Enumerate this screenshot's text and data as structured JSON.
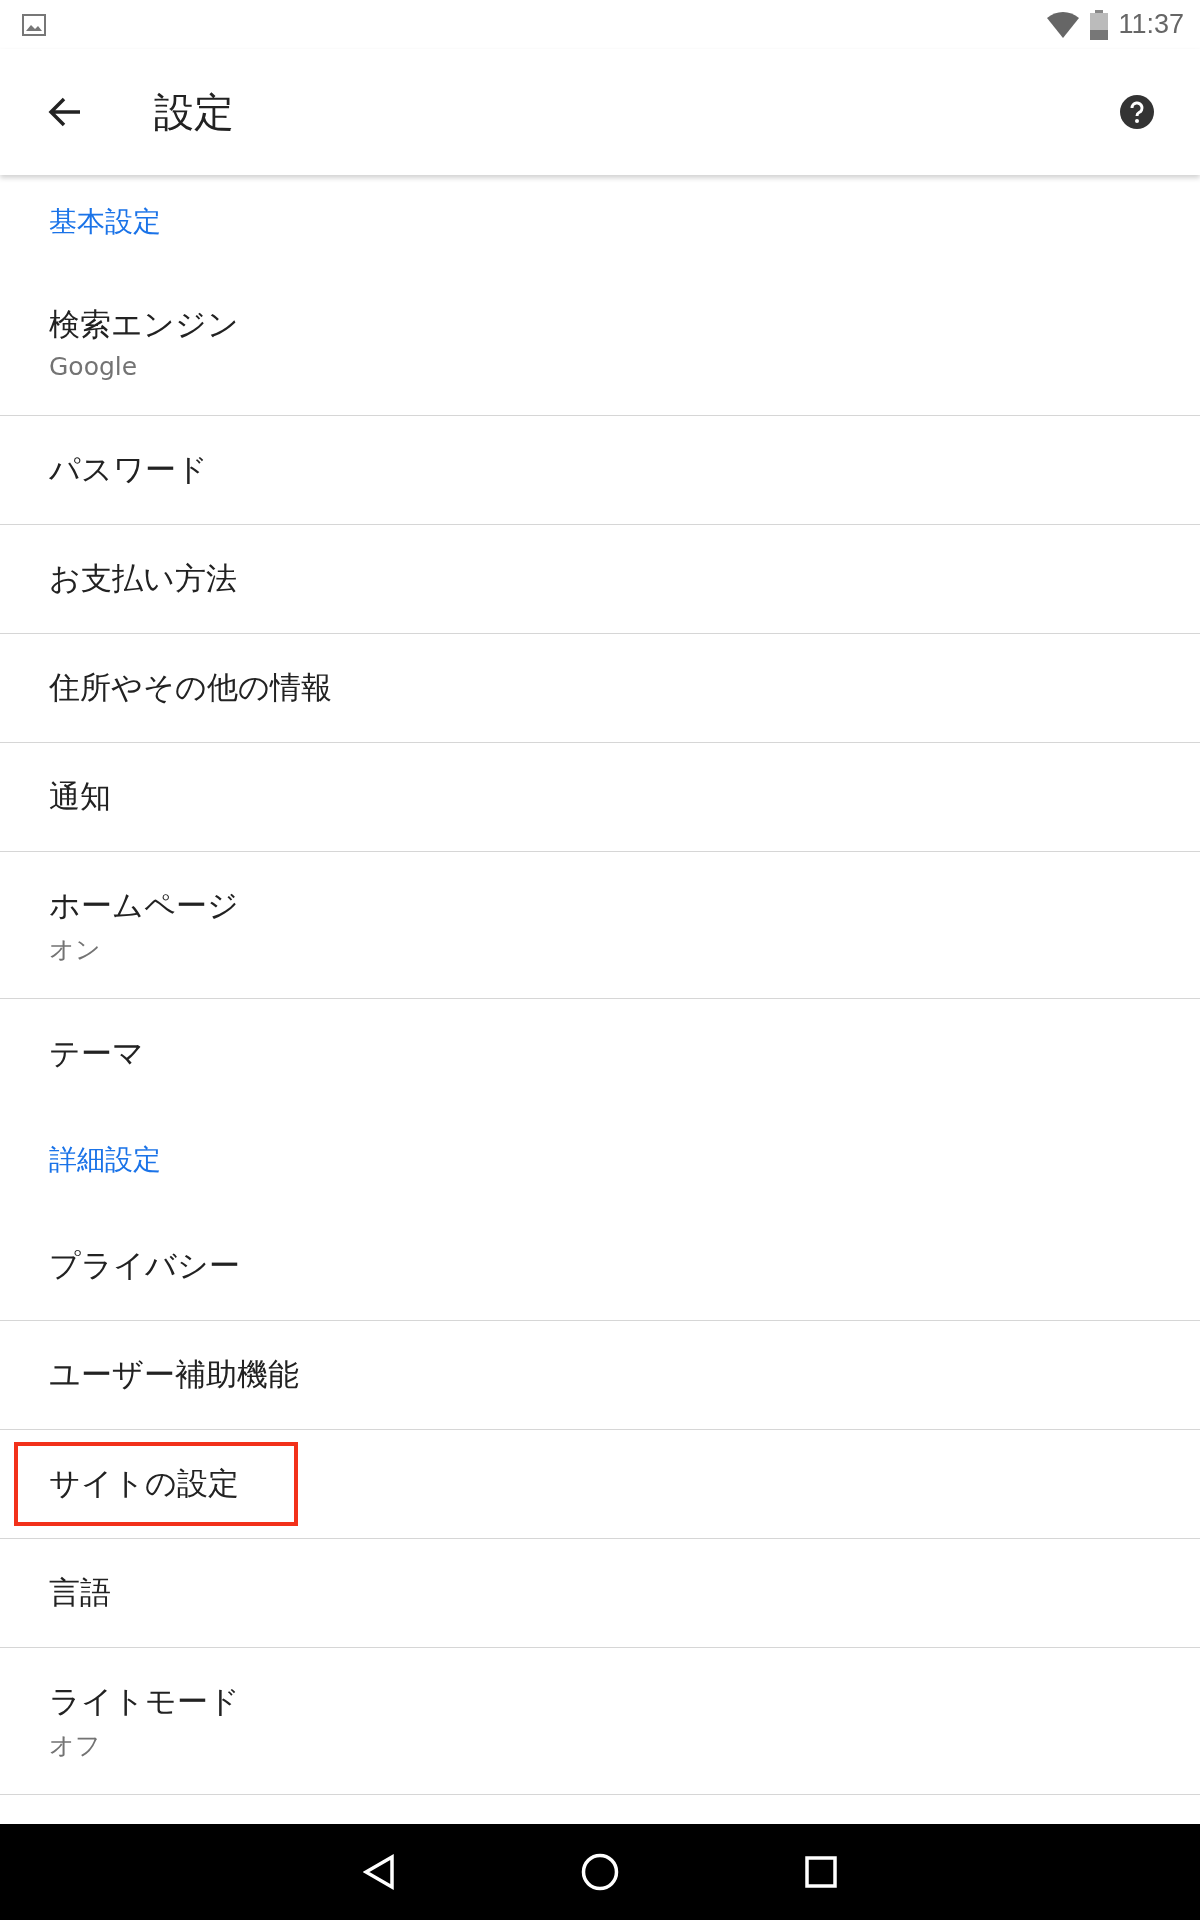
{
  "status_bar": {
    "time": "11:37"
  },
  "toolbar": {
    "title": "設定"
  },
  "sections": [
    {
      "header": "基本設定",
      "items": [
        {
          "title": "検索エンジン",
          "subtitle": "Google",
          "highlighted": false
        },
        {
          "title": "パスワード",
          "highlighted": false
        },
        {
          "title": "お支払い方法",
          "highlighted": false
        },
        {
          "title": "住所やその他の情報",
          "highlighted": false
        },
        {
          "title": "通知",
          "highlighted": false
        },
        {
          "title": "ホームページ",
          "subtitle": "オン",
          "highlighted": false
        },
        {
          "title": "テーマ",
          "highlighted": false
        }
      ]
    },
    {
      "header": "詳細設定",
      "items": [
        {
          "title": "プライバシー",
          "highlighted": false
        },
        {
          "title": "ユーザー補助機能",
          "highlighted": false
        },
        {
          "title": "サイトの設定",
          "highlighted": true
        },
        {
          "title": "言語",
          "highlighted": false
        },
        {
          "title": "ライトモード",
          "subtitle": "オフ",
          "highlighted": false
        }
      ]
    }
  ]
}
